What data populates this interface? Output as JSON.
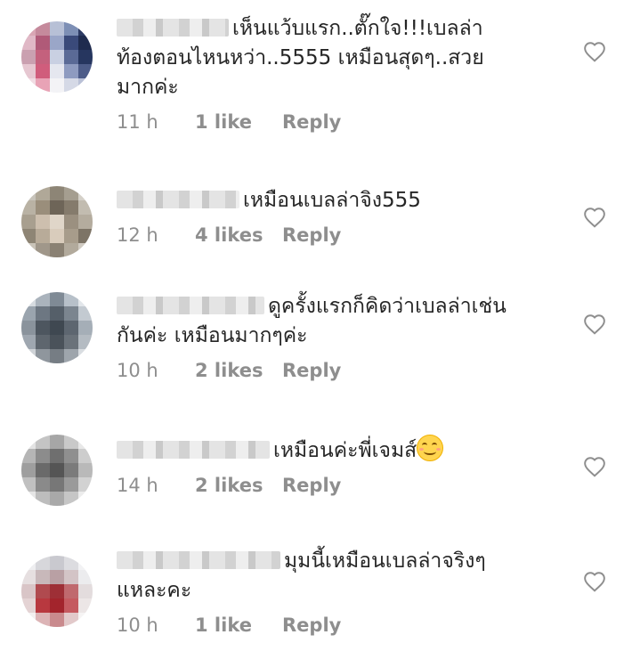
{
  "comments": [
    {
      "name_blur_width": 126,
      "lines": [
        "เห็นแว้บแรก..ตั๊กใจ!!!เบลล่า",
        "ท้องตอนไหนหว่า..5555 เหมือนสุดๆ..สวย",
        "มากค่ะ"
      ],
      "time": "11 h",
      "likes": "1 like",
      "reply": "Reply",
      "avatar": [
        "#d9a6b4",
        "#c58a9c",
        "#b7c0d6",
        "#7d8fb5",
        "#2c3a63",
        "#e0b8c6",
        "#b05a78",
        "#9aa6c8",
        "#3a4a7a",
        "#1f2b4e",
        "#caa0b0",
        "#c4617d",
        "#c9d0e2",
        "#5a6a96",
        "#26365f",
        "#e6c7d1",
        "#d05d7c",
        "#e5e7ef",
        "#8e9bc0",
        "#4d5c88",
        "#f1dce3",
        "#e8a3b6",
        "#f3f3f6",
        "#d5d9e6",
        "#b9c0d6"
      ]
    },
    {
      "name_blur_width": 138,
      "lines": [
        "เหมือนเบลล่าจิง555"
      ],
      "time": "12 h",
      "likes": "4 likes",
      "reply": "Reply",
      "avatar": [
        "#c7c3ba",
        "#b0a898",
        "#8d8576",
        "#a59e90",
        "#d4d0c8",
        "#b9b2a4",
        "#9a8e7b",
        "#6e6558",
        "#857b6c",
        "#c2bcb0",
        "#a89f8f",
        "#cdbfae",
        "#e0d6c9",
        "#9b9080",
        "#b4ac9e",
        "#8e8575",
        "#b8ab99",
        "#d9ccbc",
        "#a79c8b",
        "#7d7466",
        "#c9c3b8",
        "#a0978a",
        "#8a8173",
        "#b2aa9c",
        "#d0cbc2"
      ]
    },
    {
      "name_blur_width": 166,
      "lines": [
        "ดูครั้งแรกก็คิดว่าเบลล่าเช่น",
        "กันค่ะ เหมือนมากๆค่ะ"
      ],
      "time": "10 h",
      "likes": "2 likes",
      "reply": "Reply",
      "avatar": [
        "#d6dbe0",
        "#aab3bc",
        "#7f8a95",
        "#b7c0c9",
        "#e2e6ea",
        "#9aa4ae",
        "#6d7782",
        "#555f69",
        "#7b858f",
        "#c3cad1",
        "#8a939c",
        "#4d565f",
        "#3f4851",
        "#5d6670",
        "#a5aeb7",
        "#9fa7b0",
        "#5e666e",
        "#4a525a",
        "#6a727a",
        "#b4bbc2",
        "#cfd3d7",
        "#8f969d",
        "#767d84",
        "#9ea5ac",
        "#d9dde1"
      ]
    },
    {
      "name_blur_width": 172,
      "lines": [
        "เหมือนค่ะพี่เจมส์"
      ],
      "emoji_after": true,
      "time": "14 h",
      "likes": "2 likes",
      "reply": "Reply",
      "avatar": [
        "#e3e3e3",
        "#c4c4c4",
        "#a6a6a6",
        "#c9c9c9",
        "#e8e8e8",
        "#b5b5b5",
        "#8c8c8c",
        "#6f6f6f",
        "#8f8f8f",
        "#cdcdcd",
        "#9e9e9e",
        "#6a6a6a",
        "#555555",
        "#7b7b7b",
        "#b9b9b9",
        "#c0c0c0",
        "#8a8a8a",
        "#777777",
        "#9a9a9a",
        "#d2d2d2",
        "#e5e5e5",
        "#bdbdbd",
        "#a9a9a9",
        "#c6c6c6",
        "#ececec"
      ]
    },
    {
      "name_blur_width": 184,
      "lines": [
        "มุมนี้เหมือนเบลล่าจริงๆ",
        "แหละคะ"
      ],
      "time": "10 h",
      "likes": "1 like",
      "reply": "Reply",
      "avatar": [
        "#eeeef0",
        "#d7d7db",
        "#c9c9cf",
        "#dcdce0",
        "#f2f2f4",
        "#e6dfe0",
        "#c8b8ba",
        "#b9a0a4",
        "#d3c4c6",
        "#ececee",
        "#d9c5c7",
        "#b04a4f",
        "#9e2f36",
        "#c0696e",
        "#e3dcdd",
        "#e4d3d4",
        "#b8383f",
        "#a3242c",
        "#c55a60",
        "#ece6e6",
        "#f3f0f0",
        "#dcb4b6",
        "#c98a8d",
        "#e2c9ca",
        "#f6f4f4"
      ]
    }
  ],
  "icons": {
    "like": "heart-outline-icon",
    "emoji": "smiling-face-icon"
  },
  "colors": {
    "text": "#262626",
    "meta": "#8e8e8e",
    "background": "#ffffff"
  }
}
